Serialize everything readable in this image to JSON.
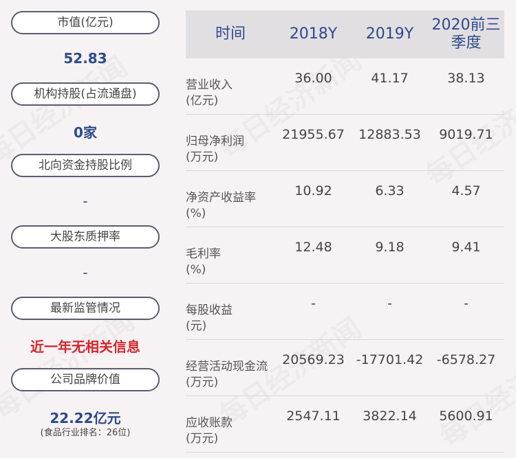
{
  "watermark": "每日经济新闻",
  "left": {
    "items": [
      {
        "label": "市值(亿元)",
        "value": "52.83"
      },
      {
        "label": "机构持股(占流通盘)",
        "value": "0家"
      },
      {
        "label": "北向资金持股比例",
        "value": "-"
      },
      {
        "label": "大股东质押率",
        "value": "-"
      },
      {
        "label": "最新监管情况",
        "value": "近一年无相关信息"
      },
      {
        "label": "公司品牌价值",
        "value": "22.22亿元",
        "note": "(食品行业排名：26位)"
      }
    ]
  },
  "table": {
    "headers": [
      "时间",
      "2018Y",
      "2019Y",
      "2020前三季度"
    ],
    "rows": [
      {
        "label": "营业收入",
        "unit": "(亿元)",
        "values": [
          "36.00",
          "41.17",
          "38.13"
        ]
      },
      {
        "label": "归母净利润",
        "unit": "(万元)",
        "values": [
          "21955.67",
          "12883.53",
          "9019.71"
        ]
      },
      {
        "label": "净资产收益率",
        "unit": "(%)",
        "values": [
          "10.92",
          "6.33",
          "4.57"
        ]
      },
      {
        "label": "毛利率",
        "unit": "(%)",
        "values": [
          "12.48",
          "9.18",
          "9.41"
        ]
      },
      {
        "label": "每股收益",
        "unit": "(元)",
        "values": [
          "-",
          "-",
          "-"
        ]
      },
      {
        "label": "经营活动现金流",
        "unit": "(万元)",
        "values": [
          "20569.23",
          "-17701.42",
          "-6578.27"
        ]
      },
      {
        "label": "应收账款",
        "unit": "(万元)",
        "values": [
          "2547.11",
          "3822.14",
          "5600.91"
        ]
      }
    ]
  }
}
